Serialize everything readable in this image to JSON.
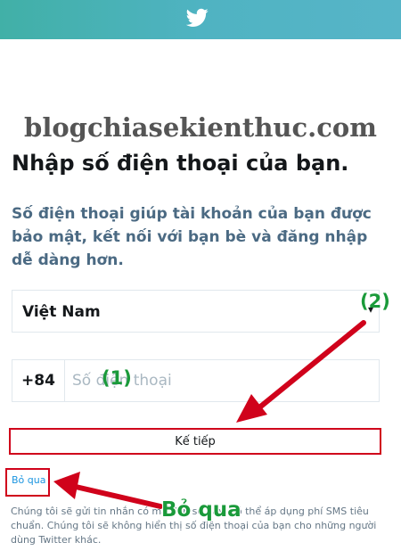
{
  "header": {
    "logo_icon": "twitter-bird-icon",
    "brand_color": "#4ab3bf"
  },
  "watermark": "blogchiasekienthuc.com",
  "page": {
    "title": "Nhập số điện thoại của bạn.",
    "subtitle": "Số điện thoại giúp tài khoản của bạn được bảo mật, kết nối với bạn bè và đăng nhập dễ dàng hơn."
  },
  "form": {
    "country_value": "Việt Nam",
    "country_caret_icon": "chevron-down-icon",
    "dial_code": "+84",
    "phone_value": "",
    "phone_placeholder": "Số điện thoại",
    "next_label": "Kế tiếp",
    "skip_label": "Bỏ qua"
  },
  "disclaimer": "Chúng tôi sẽ gửi tin nhắn có mã đến số này. Có thể áp dụng phí SMS tiêu chuẩn. Chúng tôi sẽ không hiển thị số điện thoại của bạn cho những người dùng Twitter khác.",
  "annotations": {
    "step_2": "(2)",
    "step_1": "(1)",
    "skip_callout": "Bỏ qua",
    "highlight_color": "#d0021b",
    "label_color": "#1a9a3a"
  }
}
